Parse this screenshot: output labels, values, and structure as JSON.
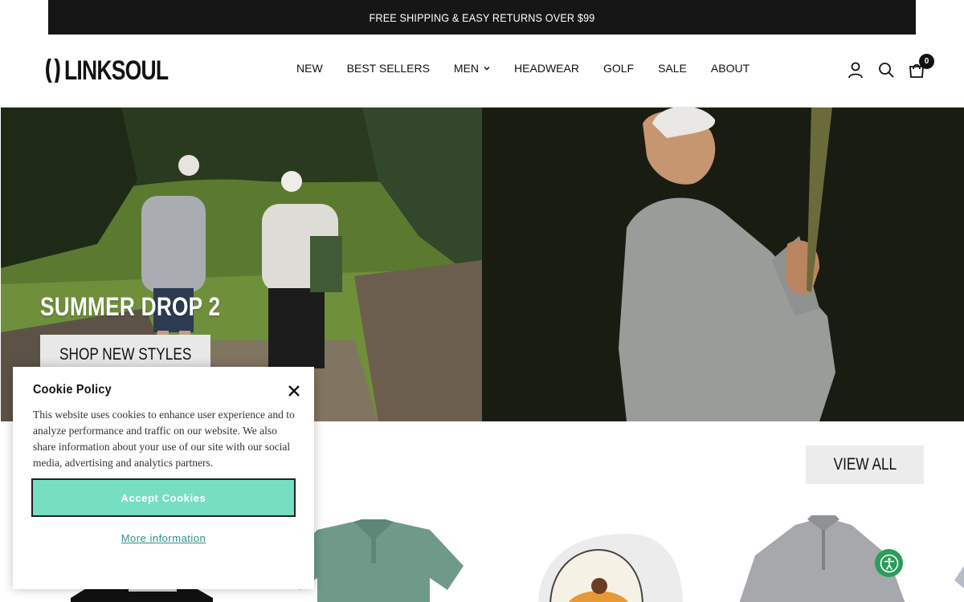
{
  "announcement": {
    "text": "FREE SHIPPING & EASY RETURNS OVER $99"
  },
  "header": {
    "logo_text": "LINKSOUL",
    "nav": [
      {
        "label": "NEW"
      },
      {
        "label": "BEST SELLERS"
      },
      {
        "label": "MEN",
        "has_dropdown": true
      },
      {
        "label": "HEADWEAR"
      },
      {
        "label": "GOLF"
      },
      {
        "label": "SALE"
      },
      {
        "label": "ABOUT"
      }
    ],
    "icons": [
      "account-icon",
      "search-icon",
      "cart-icon"
    ],
    "cart_count": "0"
  },
  "hero": {
    "title": "SUMMER DROP 2",
    "button_label": "SHOP NEW STYLES"
  },
  "collection": {
    "view_all_label": "VIEW ALL",
    "products": [
      {
        "name": "black-graphic-tee"
      },
      {
        "name": "green-polo"
      },
      {
        "name": "white-trucker-hat"
      },
      {
        "name": "grey-quarter-zip"
      }
    ]
  },
  "cookie_banner": {
    "title": "Cookie Policy",
    "body": "This website uses cookies to enhance user experience and to analyze performance and traffic on our website. We also share information about your use of our site with our social media, advertising and analytics partners.",
    "accept_label": "Accept Cookies",
    "more_label": "More information"
  },
  "accessibility": {
    "icon": "accessibility-icon"
  },
  "colors": {
    "announce_bg": "#161616",
    "accept_bg": "#76dfc1",
    "link": "#2f8f86",
    "a11y_bg": "#2a9d5a"
  }
}
